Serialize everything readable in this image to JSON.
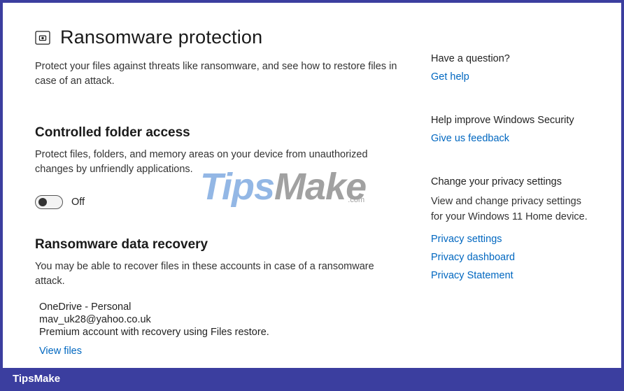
{
  "header": {
    "title": "Ransomware protection",
    "description": "Protect your files against threats like ransomware, and see how to restore files in case of an attack."
  },
  "controlled_folder": {
    "title": "Controlled folder access",
    "description": "Protect files, folders, and memory areas on your device from unauthorized changes by unfriendly applications.",
    "toggle_state": "Off"
  },
  "data_recovery": {
    "title": "Ransomware data recovery",
    "description": "You may be able to recover files in these accounts in case of a ransomware attack.",
    "account": {
      "name": "OneDrive - Personal",
      "email": "mav_uk28@yahoo.co.uk",
      "note": "Premium account with recovery using Files restore.",
      "view_files_label": "View files"
    }
  },
  "sidebar": {
    "question": {
      "title": "Have a question?",
      "link": "Get help"
    },
    "improve": {
      "title": "Help improve Windows Security",
      "link": "Give us feedback"
    },
    "privacy": {
      "title": "Change your privacy settings",
      "description": "View and change privacy settings for your Windows 11 Home device.",
      "links": [
        "Privacy settings",
        "Privacy dashboard",
        "Privacy Statement"
      ]
    }
  },
  "watermark": {
    "part1": "Tips",
    "part2": "Make",
    "dotcom": ".com"
  },
  "footer": "TipsMake"
}
